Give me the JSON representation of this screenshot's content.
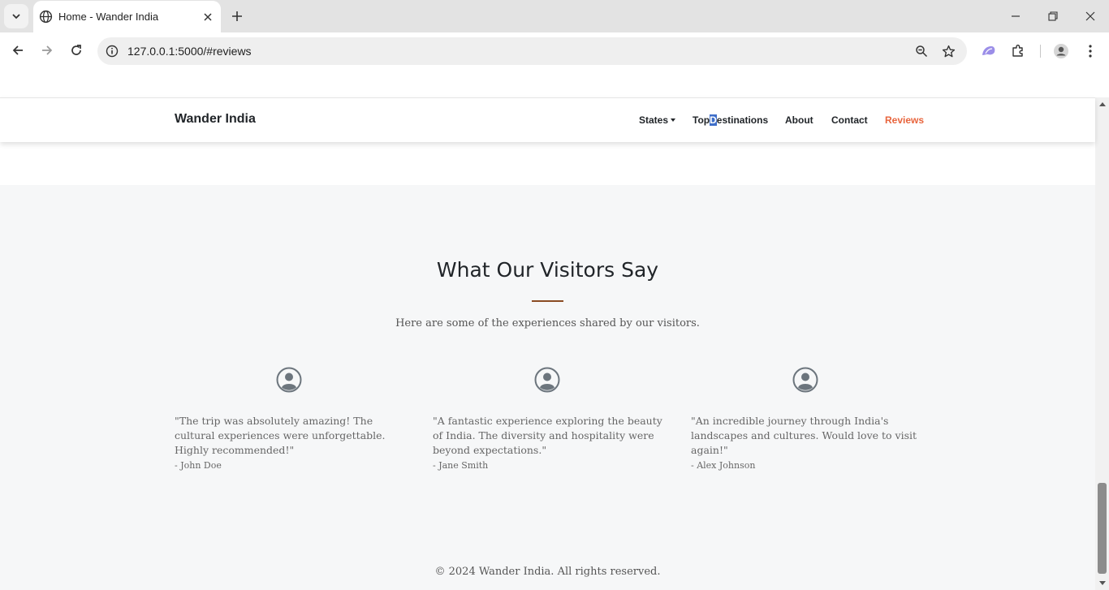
{
  "browser": {
    "tab_title": "Home - Wander India",
    "url": "127.0.0.1:5000/#reviews",
    "icons": {
      "tab_menu": "chevron-down-icon",
      "tab_favicon": "globe-icon",
      "tab_close": "close-icon",
      "new_tab": "plus-icon",
      "minimize": "minimize-icon",
      "restore": "restore-icon",
      "close_window": "close-icon",
      "back": "arrow-left-icon",
      "forward": "arrow-right-icon",
      "reload": "reload-icon",
      "site_info": "info-icon",
      "zoom": "zoom-icon",
      "bookmark": "star-icon",
      "extension": "extension-icon",
      "extensions_menu": "puzzle-icon",
      "profile": "profile-icon",
      "menu": "kebab-menu-icon"
    }
  },
  "site": {
    "brand": "Wander India",
    "nav": {
      "states": "States",
      "top_prefix": "Top",
      "top_highlight": "D",
      "top_suffix": "estinations",
      "about": "About",
      "contact": "Contact",
      "reviews": "Reviews"
    },
    "accent_color": "#e8643c"
  },
  "reviews_section": {
    "title": "What Our Visitors Say",
    "subtitle": "Here are some of the experiences shared by our visitors.",
    "items": [
      {
        "quote": "\"The trip was absolutely amazing! The cultural experiences were unforgettable. Highly recommended!\"",
        "author": "- John Doe"
      },
      {
        "quote": "\"A fantastic experience exploring the beauty of India. The diversity and hospitality were beyond expectations.\"",
        "author": "- Jane Smith"
      },
      {
        "quote": "\"An incredible journey through India's landscapes and cultures. Would love to visit again!\"",
        "author": "- Alex Johnson"
      }
    ]
  },
  "footer": {
    "text": "© 2024 Wander India. All rights reserved."
  }
}
